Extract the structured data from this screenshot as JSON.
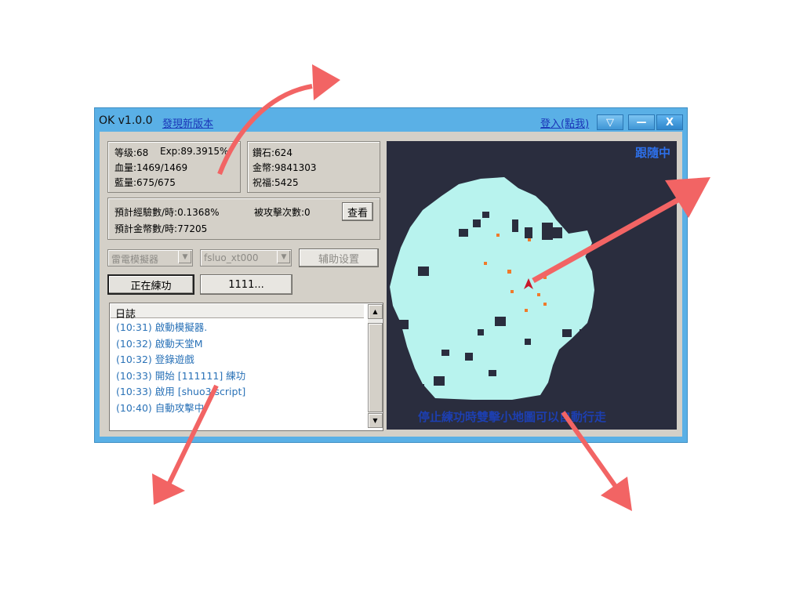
{
  "window": {
    "title": "OK v1.0.0",
    "update_link": "發現新版本",
    "login_link": "登入(點我)",
    "titlebar_buttons": {
      "menu": "▽",
      "minimize": "—",
      "close": "X"
    }
  },
  "stats": {
    "level": "等级:68",
    "exp": "Exp:89.3915%",
    "hp": "血量:1469/1469",
    "mp": "藍量:675/675",
    "diamond": "鑽石:624",
    "gold": "金幣:9841303",
    "blessing": "祝福:5425"
  },
  "rates": {
    "exp_per_hour": "預計經驗數/時:0.1368%",
    "gold_per_hour": "預計金幣數/時:77205",
    "attacked_count": "被攻擊次數:0",
    "view_button": "查看"
  },
  "controls": {
    "emulator_select": "雷電模擬器",
    "account_select": "fsluo_xt000",
    "assist_settings_button": "辅助设置",
    "training_button": "正在練功",
    "script_button": "1111..."
  },
  "log": {
    "header": "日誌",
    "lines": [
      "(10:31)  啟動模擬器.",
      "(10:32)  啟動天堂M",
      "(10:32)  登錄遊戲",
      "(10:33)  開始 [111111] 練功",
      "(10:33)  啟用 [shuo3.script]",
      "(10:40)  自動攻擊中."
    ]
  },
  "map": {
    "status": "跟隨中",
    "hint": "停止練功時雙擊小地圖可以自動行走",
    "colors": {
      "background": "#2a2d3e",
      "land": "#b8f3ee",
      "marker": "#f07a2a",
      "player": "#c8182a"
    }
  },
  "annotation": {
    "arrow_color": "#f26464"
  }
}
